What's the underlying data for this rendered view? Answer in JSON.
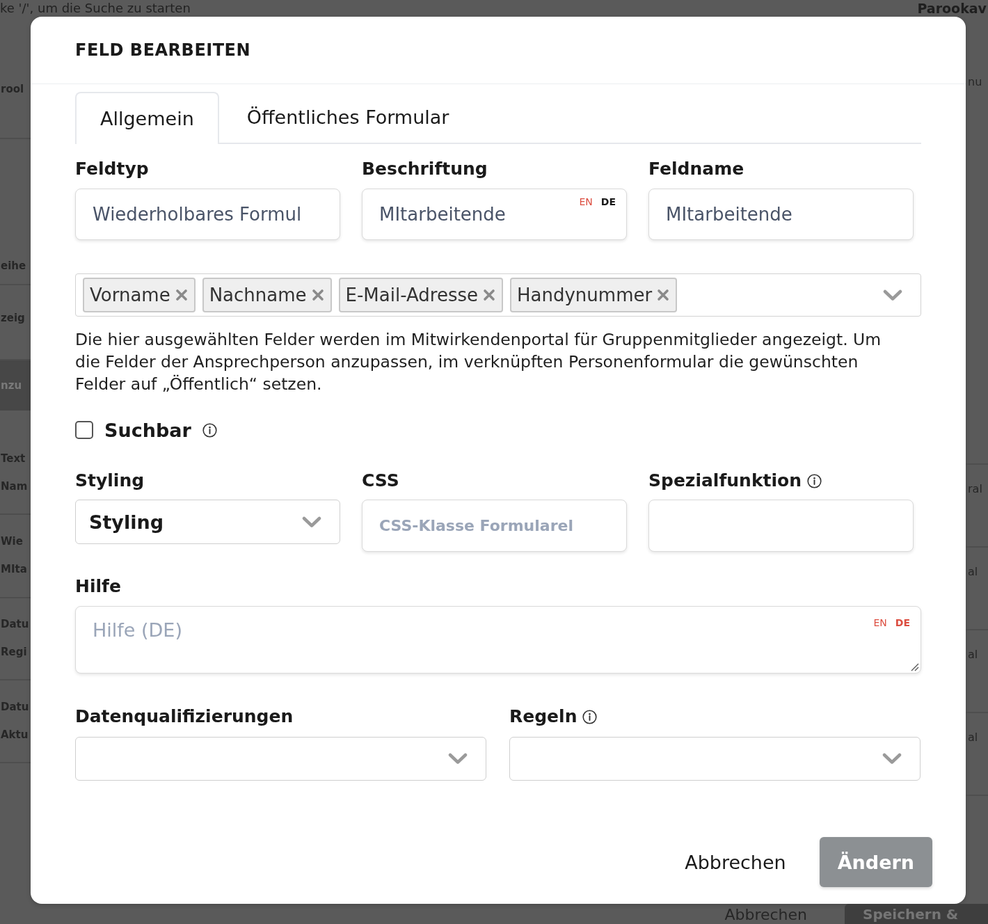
{
  "backdrop": {
    "search_hint": "ke '/', um die Suche zu starten",
    "brand": "Parookav",
    "left_rows": [
      {
        "kind": "row",
        "lines": [
          "rool"
        ]
      },
      {
        "kind": "row",
        "lines": [
          "eihe"
        ]
      },
      {
        "kind": "row",
        "lines": [
          "zeig"
        ]
      },
      {
        "kind": "band",
        "lines": [
          "nzu"
        ]
      },
      {
        "kind": "row",
        "lines": [
          "Text",
          "Nam"
        ]
      },
      {
        "kind": "row",
        "lines": [
          "Wie",
          "MIta"
        ]
      },
      {
        "kind": "row",
        "lines": [
          "Datu",
          "Regi"
        ]
      },
      {
        "kind": "row",
        "lines": [
          "Datu",
          "Aktu"
        ]
      }
    ],
    "right_rows": [
      "nu",
      "ral",
      "al",
      "al",
      "al"
    ],
    "footer_buttons": [
      {
        "kind": "cancel",
        "label": "Abbrechen"
      },
      {
        "kind": "submit",
        "label": "Speichern &"
      }
    ]
  },
  "dialog": {
    "title": "FELD BEARBEITEN",
    "tabs": [
      {
        "label": "Allgemein",
        "selected": true
      },
      {
        "label": "Öffentliches Formular",
        "selected": false
      }
    ],
    "fields": [
      {
        "label": "Feldtyp",
        "value": "Wiederholbares Formul"
      },
      {
        "label": "Beschriftung",
        "value": "MItarbeitende",
        "languages": [
          {
            "label": "EN",
            "selected": false,
            "missing": true
          },
          {
            "label": "DE",
            "selected": true,
            "missing": false
          }
        ]
      },
      {
        "label": "Feldname",
        "value": "MItarbeitende"
      }
    ],
    "visible_fields": {
      "tags": [
        "Vorname",
        "Nachname",
        "E-Mail-Adresse",
        "Handynummer"
      ],
      "hint": "Die hier ausgewählten Felder werden im Mitwirkendenportal für Gruppenmitglieder angezeigt. Um die Felder der Ansprechperson anzupassen, im verknüpften Personenformular die gewünschten Felder auf „Öffentlich“ setzen."
    },
    "searchable": {
      "label": "Suchbar",
      "checked": false,
      "info": true
    },
    "settings": [
      {
        "kind": "select",
        "label": "Styling",
        "value": "Styling",
        "info": false
      },
      {
        "kind": "input",
        "label": "CSS",
        "placeholder": "CSS-Klasse Formularel",
        "info": false
      },
      {
        "kind": "input",
        "label": "Spezialfunktion",
        "info": true
      }
    ],
    "help": {
      "label": "Hilfe",
      "placeholder": "Hilfe (DE)",
      "languages": [
        {
          "label": "EN",
          "selected": false,
          "missing": true
        },
        {
          "label": "DE",
          "selected": true,
          "missing": true
        }
      ]
    },
    "selects": [
      {
        "label": "Datenqualifizierungen",
        "info": false
      },
      {
        "label": "Regeln",
        "info": true
      }
    ],
    "buttons": [
      {
        "kind": "cancel",
        "label": "Abbrechen"
      },
      {
        "kind": "submit",
        "label": "Ändern",
        "disabled": true
      }
    ]
  }
}
